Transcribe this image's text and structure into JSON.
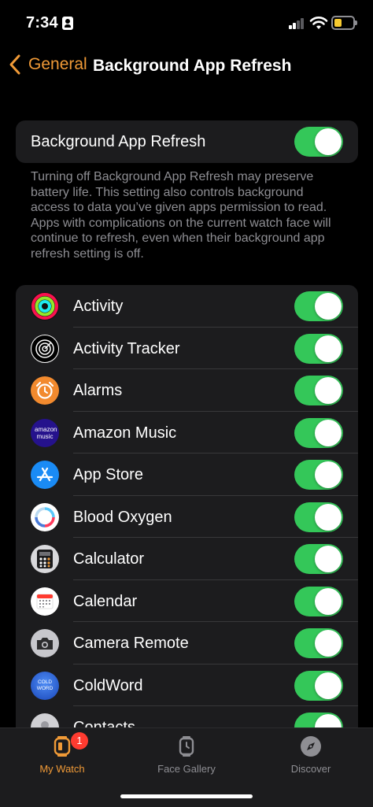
{
  "status": {
    "time": "7:34"
  },
  "nav": {
    "back_label": "General",
    "title": "Background App Refresh"
  },
  "main_setting": {
    "label": "Background App Refresh",
    "enabled": true
  },
  "description": "Turning off Background App Refresh may preserve battery life. This setting also controls background access to data you’ve given apps permission to read. Apps with complications on the current watch face will continue to refresh, even when their background app refresh setting is off.",
  "apps": [
    {
      "name": "Activity",
      "icon": "activity-rings-icon",
      "enabled": true
    },
    {
      "name": "Activity Tracker",
      "icon": "activity-tracker-icon",
      "enabled": true
    },
    {
      "name": "Alarms",
      "icon": "alarm-clock-icon",
      "enabled": true
    },
    {
      "name": "Amazon Music",
      "icon": "amazon-music-icon",
      "icon_text": "amazon music",
      "enabled": true
    },
    {
      "name": "App Store",
      "icon": "app-store-icon",
      "enabled": true
    },
    {
      "name": "Blood Oxygen",
      "icon": "blood-oxygen-icon",
      "enabled": true
    },
    {
      "name": "Calculator",
      "icon": "calculator-icon",
      "enabled": true
    },
    {
      "name": "Calendar",
      "icon": "calendar-icon",
      "enabled": true
    },
    {
      "name": "Camera Remote",
      "icon": "camera-icon",
      "enabled": true
    },
    {
      "name": "ColdWord",
      "icon": "coldword-icon",
      "icon_text": "COLD WORD",
      "enabled": true
    },
    {
      "name": "Contacts",
      "icon": "contacts-icon",
      "enabled": true
    }
  ],
  "tabs": [
    {
      "label": "My Watch",
      "icon": "watch-icon",
      "active": true,
      "badge": "1"
    },
    {
      "label": "Face Gallery",
      "icon": "face-gallery-icon",
      "active": false
    },
    {
      "label": "Discover",
      "icon": "compass-icon",
      "active": false
    }
  ],
  "colors": {
    "accent": "#f09a37",
    "toggle_on": "#34c759",
    "badge": "#ff3b30"
  }
}
